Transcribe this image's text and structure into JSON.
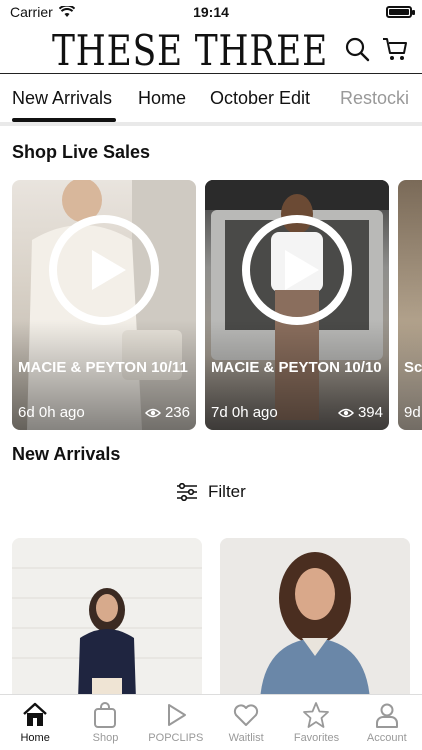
{
  "status": {
    "carrier": "Carrier",
    "time": "19:14"
  },
  "header": {
    "brand": "THESE THREE"
  },
  "tabs": [
    {
      "label": "New Arrivals",
      "active": true
    },
    {
      "label": "Home",
      "active": false
    },
    {
      "label": "October Edit",
      "active": false
    },
    {
      "label": "Restocki",
      "active": false
    }
  ],
  "live": {
    "title": "Shop Live Sales",
    "cards": [
      {
        "title": "MACIE & PEYTON 10/11",
        "ago": "6d 0h ago",
        "views": "236"
      },
      {
        "title": "MACIE & PEYTON 10/10",
        "ago": "7d 0h ago",
        "views": "394"
      },
      {
        "title": "Sc",
        "ago": "9d",
        "views": ""
      }
    ]
  },
  "new_arrivals": {
    "title": "New Arrivals",
    "filter_label": "Filter"
  },
  "tabbar": [
    {
      "label": "Home",
      "icon": "home-icon",
      "active": true
    },
    {
      "label": "Shop",
      "icon": "bag-icon",
      "active": false
    },
    {
      "label": "POPCLIPS",
      "icon": "play-icon",
      "active": false
    },
    {
      "label": "Waitlist",
      "icon": "heart-icon",
      "active": false
    },
    {
      "label": "Favorites",
      "icon": "star-icon",
      "active": false
    },
    {
      "label": "Account",
      "icon": "person-icon",
      "active": false
    }
  ],
  "colors": {
    "accent": "#111111",
    "muted": "#999999"
  }
}
